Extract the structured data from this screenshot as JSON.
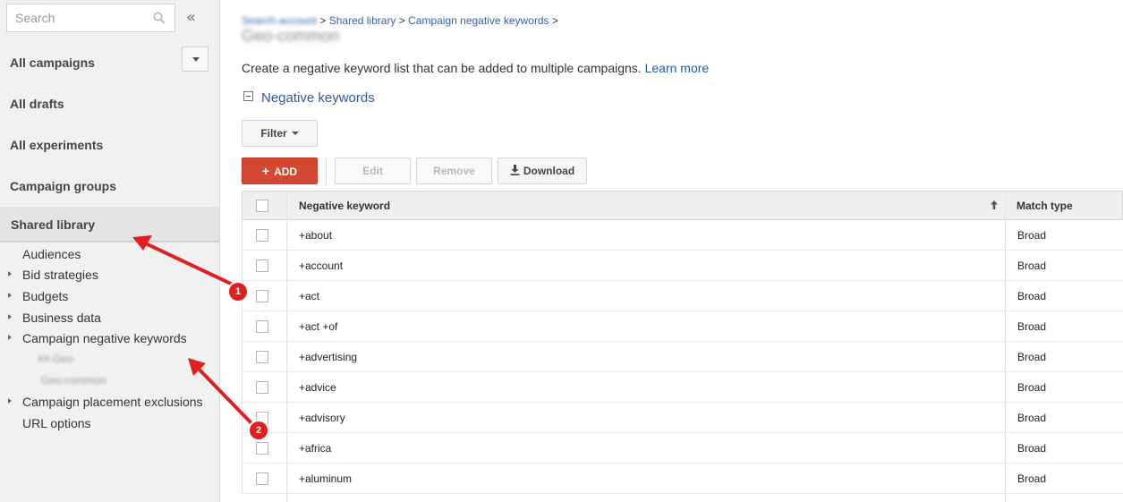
{
  "sidebar": {
    "search_placeholder": "Search",
    "collapse_label": "«",
    "nav": {
      "all_campaigns": "All campaigns",
      "all_drafts": "All drafts",
      "all_experiments": "All experiments",
      "campaign_groups": "Campaign groups",
      "shared_library": "Shared library"
    },
    "library_items": {
      "audiences": "Audiences",
      "bid_strategies": "Bid strategies",
      "budgets": "Budgets",
      "business_data": "Business data",
      "campaign_negative_keywords": "Campaign negative keywords",
      "campaign_placement_exclusions": "Campaign placement exclusions",
      "url_options": "URL options"
    },
    "blurred_lists": [
      "##-Geo",
      "Geo-common"
    ]
  },
  "breadcrumb": {
    "account": "Search-account",
    "sep": " > ",
    "shared_library": "Shared library",
    "campaign_negative_keywords": "Campaign negative keywords",
    "trail_end": " >"
  },
  "page": {
    "title": "Geo-common",
    "description": "Create a negative keyword list that can be added to multiple campaigns.",
    "learn_more": "Learn more",
    "section_title": "Negative keywords"
  },
  "toolbar": {
    "filter": "Filter",
    "add": "ADD",
    "add_icon": "+",
    "edit": "Edit",
    "remove": "Remove",
    "download": "Download"
  },
  "table": {
    "headers": {
      "keyword": "Negative keyword",
      "match_type": "Match type"
    },
    "rows": [
      {
        "keyword": "+about",
        "match": "Broad"
      },
      {
        "keyword": "+account",
        "match": "Broad"
      },
      {
        "keyword": "+act",
        "match": "Broad"
      },
      {
        "keyword": "+act +of",
        "match": "Broad"
      },
      {
        "keyword": "+advertising",
        "match": "Broad"
      },
      {
        "keyword": "+advice",
        "match": "Broad"
      },
      {
        "keyword": "+advisory",
        "match": "Broad"
      },
      {
        "keyword": "+africa",
        "match": "Broad"
      },
      {
        "keyword": "+aluminum",
        "match": "Broad"
      }
    ]
  },
  "annotations": {
    "badge_1": "1",
    "badge_2": "2",
    "arrow_color": "#e02020"
  },
  "colors": {
    "add_button": "#d44732",
    "link": "#1a5bbf",
    "sidebar_bg": "#f1f1f1"
  }
}
